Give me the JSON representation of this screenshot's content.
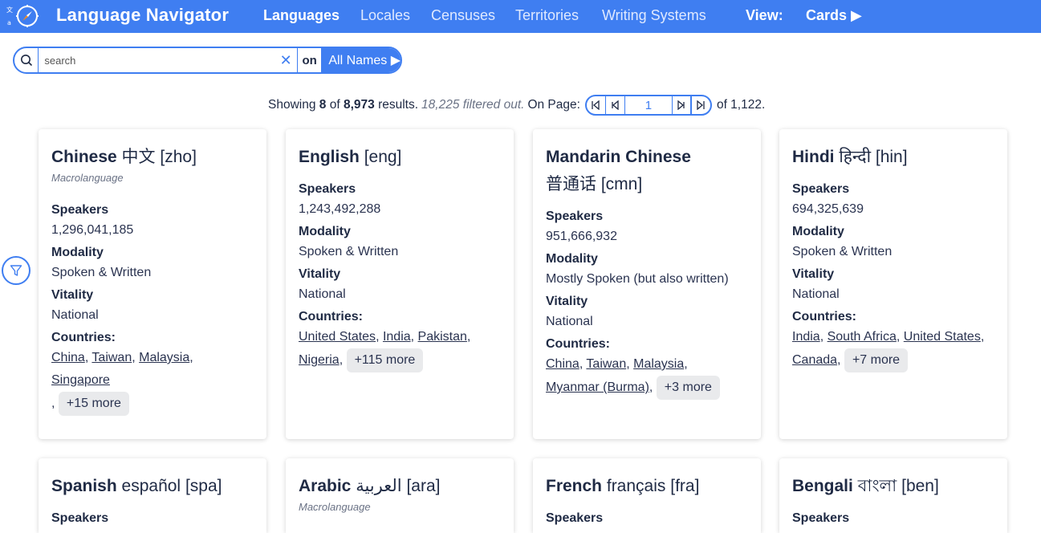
{
  "header": {
    "app_title": "Language Navigator",
    "nav": [
      "Languages",
      "Locales",
      "Censuses",
      "Territories",
      "Writing Systems"
    ],
    "view_label": "View:",
    "view_value": "Cards ▶"
  },
  "search": {
    "placeholder": "search",
    "on_label": "on",
    "names_mode": "All Names ▶"
  },
  "results": {
    "prefix": "Showing",
    "shown": "8",
    "of_word": "of",
    "total": "8,973",
    "results_word": "results.",
    "filtered": "18,225 filtered out.",
    "on_page": "On Page:",
    "page": "1",
    "page_total": "of 1,122."
  },
  "labels": {
    "speakers": "Speakers",
    "modality": "Modality",
    "vitality": "Vitality",
    "countries": "Countries:"
  },
  "cards": [
    {
      "name": "Chinese",
      "native": "中文",
      "code": "[zho]",
      "subtitle": "Macrolanguage",
      "speakers": "1,296,041,185",
      "modality": "Spoken & Written",
      "vitality": "National",
      "countries": [
        "China",
        "Taiwan",
        "Malaysia",
        "Singapore"
      ],
      "more": "+15 more"
    },
    {
      "name": "English",
      "native": "",
      "code": "[eng]",
      "subtitle": "",
      "speakers": "1,243,492,288",
      "modality": "Spoken & Written",
      "vitality": "National",
      "countries": [
        "United States",
        "India",
        "Pakistan",
        "Nigeria"
      ],
      "more": "+115 more"
    },
    {
      "name": "Mandarin Chinese",
      "native": "普通话",
      "code": "[cmn]",
      "subtitle": "",
      "speakers": "951,666,932",
      "modality": "Mostly Spoken (but also written)",
      "vitality": "National",
      "countries": [
        "China",
        "Taiwan",
        "Malaysia",
        "Myanmar (Burma)"
      ],
      "more": "+3 more"
    },
    {
      "name": "Hindi",
      "native": "हिन्दी",
      "code": "[hin]",
      "subtitle": "",
      "speakers": "694,325,639",
      "modality": "Spoken & Written",
      "vitality": "National",
      "countries": [
        "India",
        "South Africa",
        "United States",
        "Canada"
      ],
      "more": "+7 more"
    },
    {
      "name": "Spanish",
      "native": "español",
      "code": "[spa]",
      "subtitle": ""
    },
    {
      "name": "Arabic",
      "native": "العربية",
      "code": "[ara]",
      "subtitle": "Macrolanguage"
    },
    {
      "name": "French",
      "native": "français",
      "code": "[fra]",
      "subtitle": ""
    },
    {
      "name": "Bengali",
      "native": "বাংলা",
      "code": "[ben]",
      "subtitle": ""
    }
  ],
  "colors": {
    "accent": "#3f7ef1",
    "text": "#1f2a44",
    "pill": "#e9eaec"
  }
}
